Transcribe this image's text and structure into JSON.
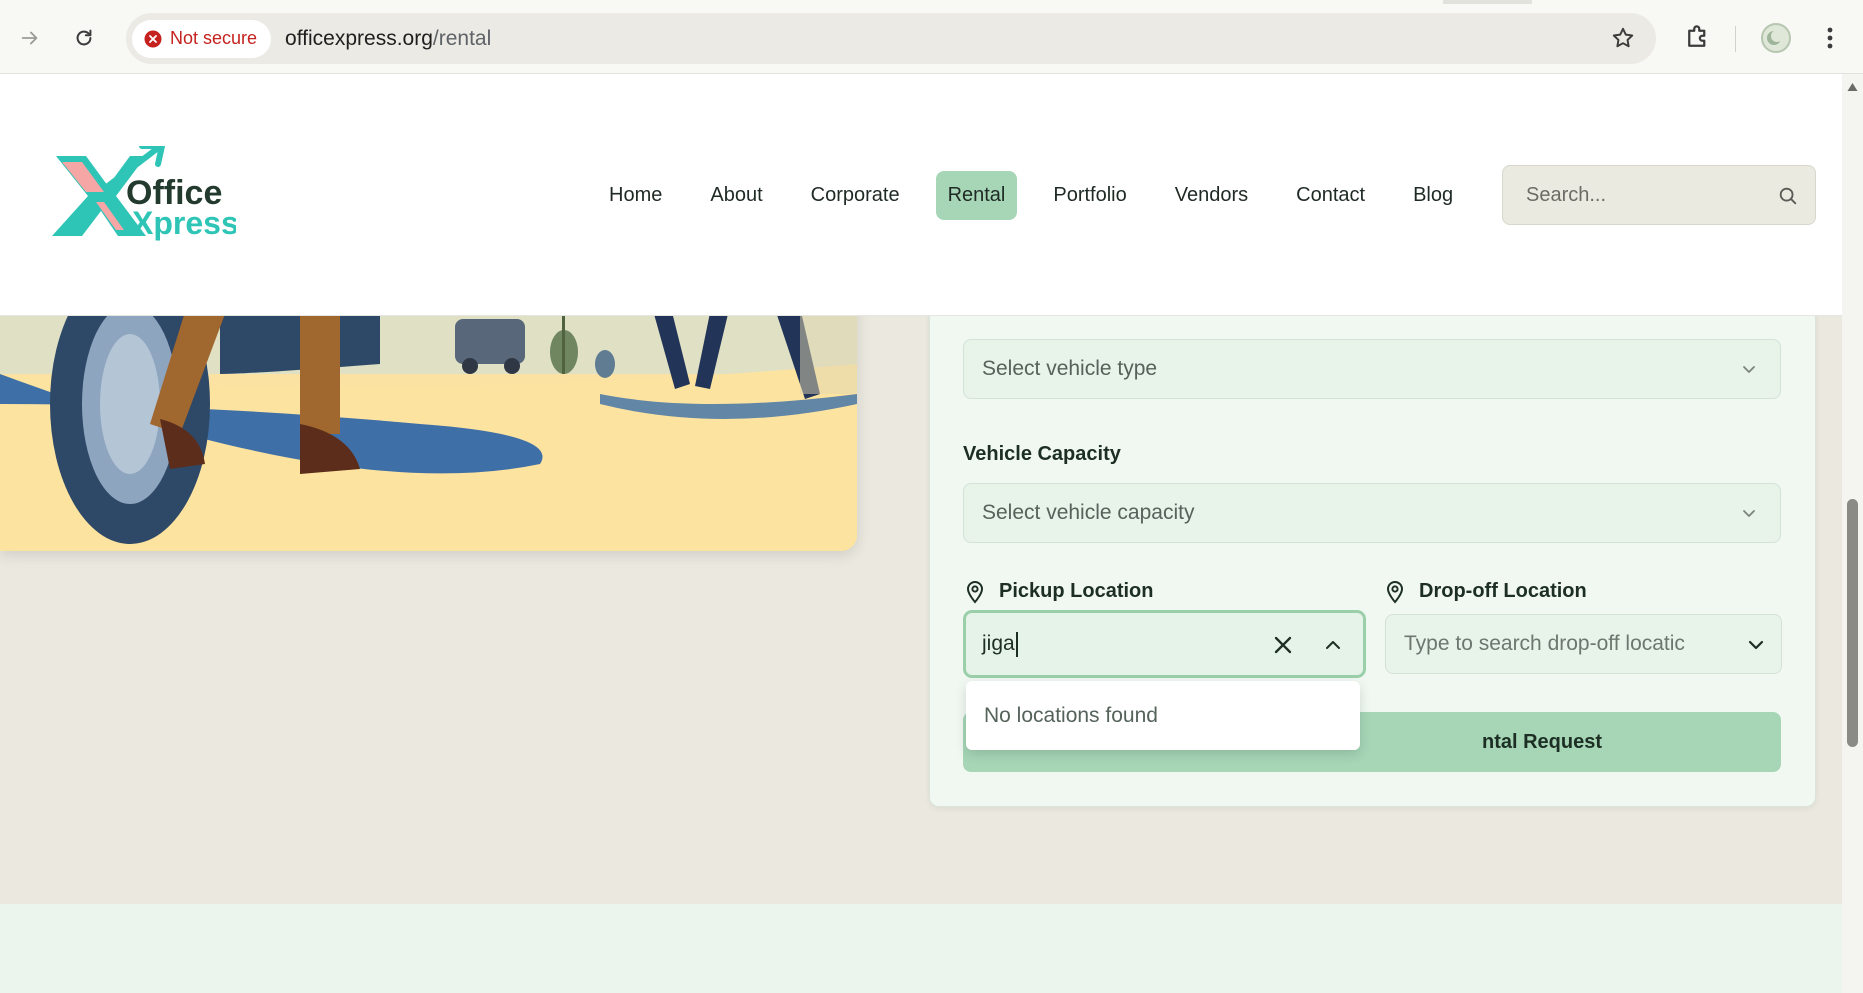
{
  "browser": {
    "security_label": "Not secure",
    "url_host": "officexpress.org",
    "url_path": "/rental"
  },
  "header": {
    "logo_line1": "Office",
    "logo_line2": "Xpress",
    "nav": [
      {
        "label": "Home"
      },
      {
        "label": "About"
      },
      {
        "label": "Corporate"
      },
      {
        "label": "Rental",
        "active": true
      },
      {
        "label": "Portfolio"
      },
      {
        "label": "Vendors"
      },
      {
        "label": "Contact"
      },
      {
        "label": "Blog"
      }
    ],
    "search_placeholder": "Search..."
  },
  "form": {
    "vehicle_type_select": "Select vehicle type",
    "vehicle_capacity_label": "Vehicle Capacity",
    "vehicle_capacity_select": "Select vehicle capacity",
    "pickup_label": "Pickup Location",
    "pickup_value": "jiga",
    "dropoff_label": "Drop-off Location",
    "dropoff_placeholder": "Type to search drop-off locatic",
    "submit_label_visible": "ntal Request",
    "dropdown_message": "No locations found"
  },
  "colors": {
    "accent": "#a6d6b6",
    "card_background": "#f1f8f2",
    "page_background": "#ebe9df",
    "security_warning": "#c5221f"
  }
}
